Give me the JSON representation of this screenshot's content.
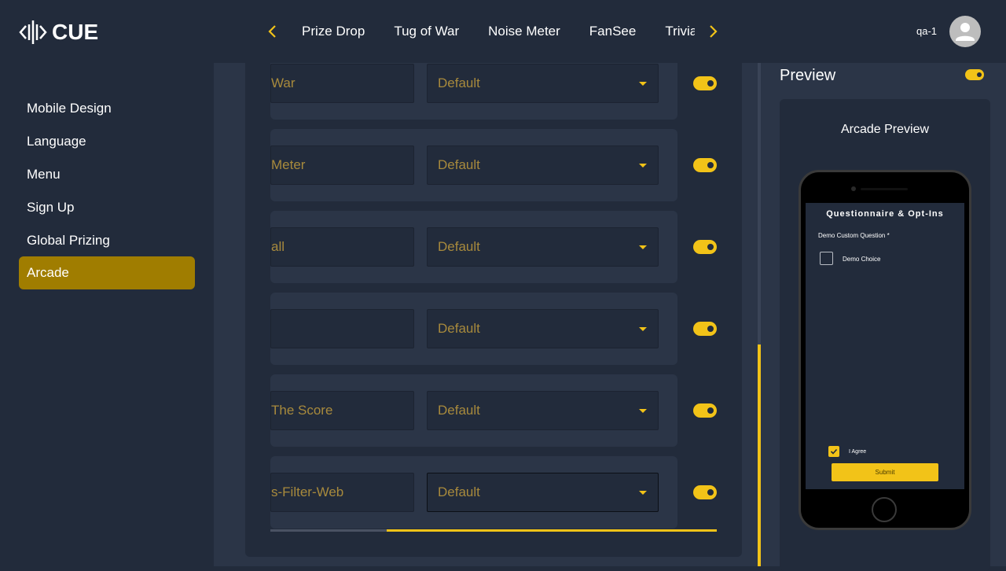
{
  "brand": {
    "logo_text": "CUE",
    "accent_color": "#f2c318"
  },
  "header": {
    "tabs": [
      "Prize Drop",
      "Tug of War",
      "Noise Meter",
      "FanSee",
      "Trivia"
    ],
    "prev_icon": "chevron-left-icon",
    "next_icon": "chevron-right-icon",
    "user_name": "qa-1",
    "avatar_icon": "person-icon"
  },
  "sidebar": {
    "items": [
      {
        "label": "Mobile Design",
        "active": false
      },
      {
        "label": "Language",
        "active": false
      },
      {
        "label": "Menu",
        "active": false
      },
      {
        "label": "Sign Up",
        "active": false
      },
      {
        "label": "Global Prizing",
        "active": false
      },
      {
        "label": "Arcade",
        "active": true
      }
    ],
    "active_color": "#a07d00"
  },
  "arcade_rows": [
    {
      "name_visible": "War",
      "select": "Default",
      "enabled": true
    },
    {
      "name_visible": "Meter",
      "select": "Default",
      "enabled": true
    },
    {
      "name_visible": "all",
      "select": "Default",
      "enabled": true
    },
    {
      "name_visible": "",
      "select": "Default",
      "enabled": true
    },
    {
      "name_visible": "The Score",
      "select": "Default",
      "enabled": true
    },
    {
      "name_visible": "s-Filter-Web",
      "select": "Default",
      "enabled": true
    }
  ],
  "scrollbars": {
    "horizontal_thumb_start": 0.26,
    "horizontal_thumb_end": 1.0,
    "vertical_thumb_start": 0.56,
    "vertical_thumb_end": 1.0
  },
  "preview": {
    "title": "Preview",
    "enabled": true,
    "card_title": "Arcade Preview",
    "screen": {
      "title": "Questionnaire & Opt-Ins",
      "question": "Demo Custom Question *",
      "choice": "Demo Choice",
      "choice_checked": false,
      "agree_label": "I Agree",
      "agree_checked": true,
      "submit_label": "Submit"
    }
  }
}
